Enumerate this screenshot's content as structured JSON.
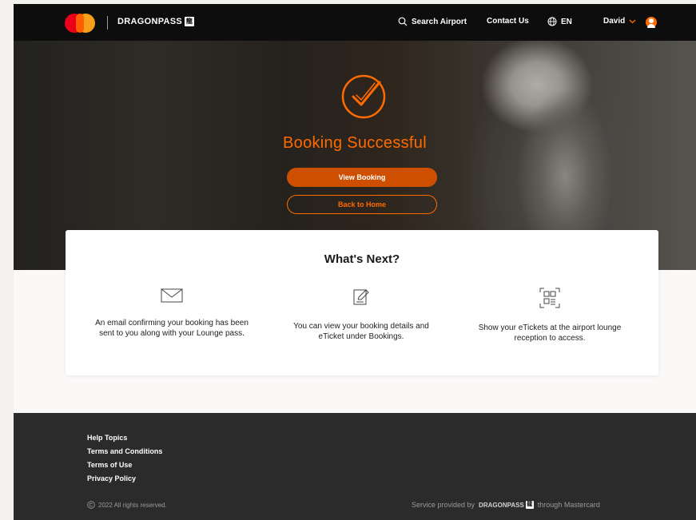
{
  "header": {
    "brand": "DRAGONPASS",
    "brand_badge": "龍",
    "search_label": "Search Airport",
    "contact_label": "Contact Us",
    "language": "EN",
    "user_name": "David"
  },
  "hero": {
    "title": "Booking Successful",
    "view_booking_label": "View Booking",
    "back_home_label": "Back to Home"
  },
  "whats_next": {
    "title": "What's Next?",
    "steps": [
      {
        "icon": "envelope-icon",
        "text": "An email confirming your booking has been sent to you along with your Lounge pass."
      },
      {
        "icon": "edit-document-icon",
        "text": "You can view your booking details and eTicket under Bookings."
      },
      {
        "icon": "qr-code-icon",
        "text": "Show your eTickets at the airport lounge reception to access."
      }
    ]
  },
  "footer": {
    "links": [
      "Help Topics",
      "Terms and Conditions",
      "Terms of Use",
      "Privacy Policy"
    ],
    "copyright": "2022 All rights reserved.",
    "service_prefix": "Service provided by",
    "service_brand": "DRAGONPASS",
    "service_suffix": "through Mastercard"
  },
  "colors": {
    "accent": "#ff6a00",
    "button": "#cf4f00",
    "header_bg": "#0d0d0d",
    "footer_bg": "#2b2b2b"
  }
}
